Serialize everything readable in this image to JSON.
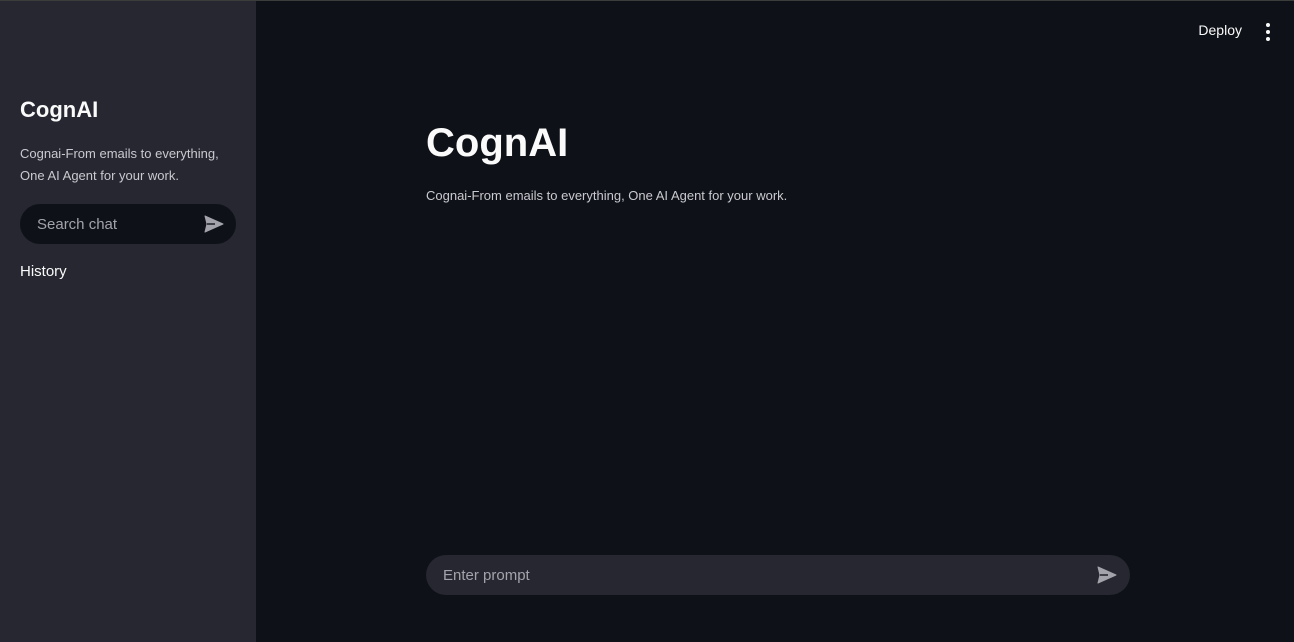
{
  "sidebar": {
    "title": "CognAI",
    "description": "Cognai-From emails to everything, One AI Agent for your work.",
    "search_placeholder": "Search chat",
    "history_label": "History",
    "send_icon": "send-icon"
  },
  "header": {
    "deploy_label": "Deploy",
    "menu_icon": "more-vertical-icon"
  },
  "main": {
    "title": "CognAI",
    "description": "Cognai-From emails to everything, One AI Agent for your work.",
    "prompt_placeholder": "Enter prompt",
    "send_icon": "send-icon"
  },
  "colors": {
    "background": "#0e1117",
    "sidebar": "#262730",
    "input": "#262730",
    "text": "#fafafa",
    "muted": "#a3a4ab"
  }
}
